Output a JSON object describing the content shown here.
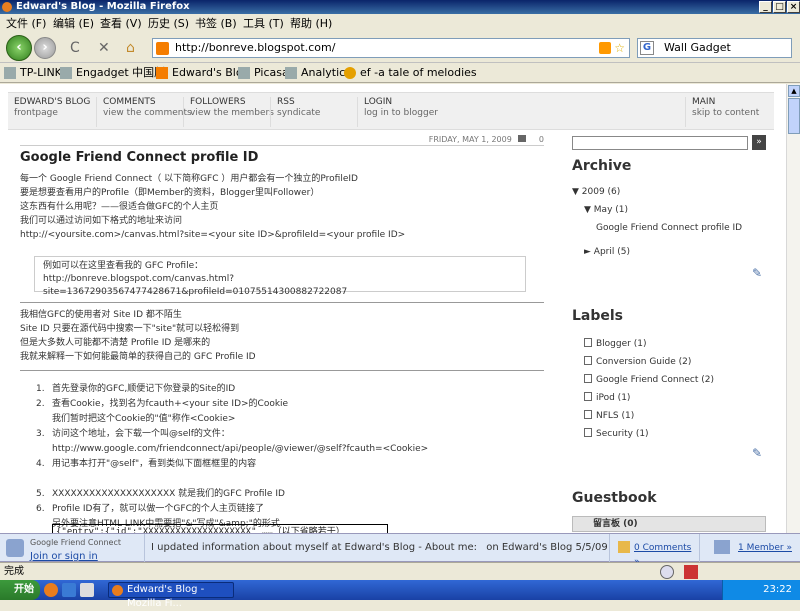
{
  "window": {
    "title": "Edward's Blog - Mozilla Firefox",
    "min": "_",
    "max": "□",
    "close": "×"
  },
  "menu": [
    "文件 (F)",
    "编辑 (E)",
    "查看 (V)",
    "历史 (S)",
    "书签 (B)",
    "工具 (T)",
    "帮助 (H)"
  ],
  "nav": {
    "back": "‹",
    "forward": "›",
    "reload": "C",
    "stop": "✕",
    "home": "⌂",
    "url": "http://bonreve.blogspot.com/",
    "search_value": "Wall Gadget",
    "search_engine": "G"
  },
  "bookmarks": [
    "TP-LINK",
    "Engadget 中国版",
    "Edward's Blog",
    "Picasa",
    "Analytics",
    "ef -a tale of melodies"
  ],
  "blognav": [
    {
      "title": "EDWARD'S BLOG",
      "sub": "frontpage"
    },
    {
      "title": "COMMENTS",
      "sub": "view the comments"
    },
    {
      "title": "FOLLOWERS",
      "sub": "view the members"
    },
    {
      "title": "RSS",
      "sub": "syndicate"
    },
    {
      "title": "LOGIN",
      "sub": "log in to blogger"
    },
    {
      "title": "MAIN",
      "sub": "skip to content"
    }
  ],
  "post": {
    "date": "FRIDAY, MAY 1, 2009",
    "comments": "0",
    "title": "Google Friend Connect profile ID",
    "p1": [
      "每一个 Google Friend Connect（ 以下简称GFC ）用户都会有一个独立的ProfileID",
      "要是想要查看用户的Profile（即Member的资料，Blogger里叫Follower）",
      "这东西有什么用呢？——很适合做GFC的个人主页",
      "我们可以通过访问如下格式的地址来访问",
      "http://<yoursite.com>/canvas.html?site=<your site ID>&profileId=<your profile ID>"
    ],
    "quote": [
      "例如可以在这里查看我的 GFC Profile：",
      "http://bonreve.blogspot.com/canvas.html?site=13672903567477428671&profileId=01075514300882722087"
    ],
    "p2": [
      "我相信GFC的使用者对 Site ID 都不陌生",
      "Site ID 只要在源代码中搜索一下\"site\"就可以轻松得到",
      "但是大多数人可能都不清楚 Profile ID 是哪来的",
      "我就来解释一下如何能最简单的获得自己的 GFC Profile ID"
    ],
    "steps": [
      {
        "n": "1.",
        "lines": [
          "首先登录你的GFC,顺便记下你登录的Site的ID"
        ]
      },
      {
        "n": "2.",
        "lines": [
          "查看Cookie，找到名为fcauth+<your site ID>的Cookie",
          "我们暂时把这个Cookie的\"值\"称作<Cookie>"
        ]
      },
      {
        "n": "3.",
        "lines": [
          "访问这个地址，会下载一个叫@self的文件：",
          "http://www.google.com/friendconnect/api/people/@viewer/@self?fcauth=<Cookie>"
        ]
      },
      {
        "n": "4.",
        "lines": [
          "用记事本打开\"@self\"，看到类似下面框框里的内容"
        ]
      },
      {
        "n": "5.",
        "lines": [
          "XXXXXXXXXXXXXXXXXXXX 就是我们的GFC Profile ID"
        ]
      },
      {
        "n": "6.",
        "lines": [
          "Profile ID有了，就可以做一个GFC的个人主页链接了",
          "另外要注意HTML LINK中需要把\"&\"写成\"&amp;\"的形式"
        ]
      }
    ],
    "code": "{\"entry\":{\"id\":\"XXXXXXXXXXXXXXXXXXXX\" ……（以下省略若干）"
  },
  "sidebar": {
    "search_btn": "»",
    "archive": {
      "heading": "Archive",
      "year": "▼ 2009 (6)",
      "month": "▼ May (1)",
      "post": "Google Friend Connect profile ID",
      "april": "► April (5)"
    },
    "labels": {
      "heading": "Labels",
      "items": [
        "Blogger (1)",
        "Conversion Guide (2)",
        "Google Friend Connect (2)",
        "iPod (1)",
        "NFLS (1)",
        "Security (1)"
      ]
    },
    "guestbook": {
      "heading": "Guestbook",
      "widget": "留言板 (0)"
    },
    "tools_icon": "✎"
  },
  "friendbar": {
    "brand": "Google Friend Connect",
    "join": "Join or sign in",
    "activity": "I updated information about myself at Edward's Blog - About me:",
    "activity_tail": "on Edward's Blog  5/5/09",
    "comments": "0 Comments »",
    "members": "1 Member »"
  },
  "status": {
    "text": "完成"
  },
  "taskbar": {
    "start": "开始",
    "item": "Edward's Blog - Mozilla Fi...",
    "time": "23:22"
  }
}
